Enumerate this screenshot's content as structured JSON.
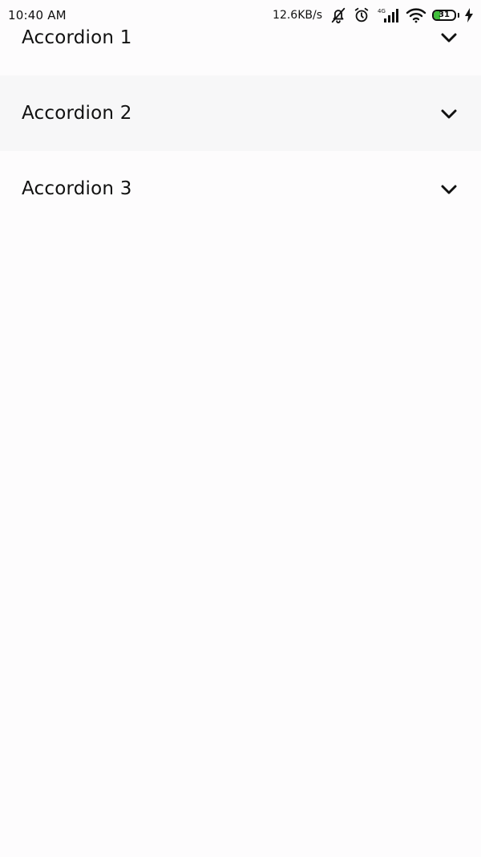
{
  "status_bar": {
    "time": "10:40 AM",
    "net_speed": "12.6KB/s",
    "icons": [
      "mute-icon",
      "alarm-icon",
      "signal-4g-icon",
      "wifi-icon",
      "battery-icon",
      "charging-icon"
    ],
    "network_label": "4G",
    "battery_level": "31",
    "battery_fraction": 0.31,
    "battery_color": "#3fbf3a"
  },
  "accordions": [
    {
      "title": "Accordion 1",
      "icon": "chevron-down-icon"
    },
    {
      "title": "Accordion 2",
      "icon": "chevron-down-icon"
    },
    {
      "title": "Accordion 3",
      "icon": "chevron-down-icon"
    }
  ],
  "colors": {
    "background": "#fdfcfd",
    "text": "#111111"
  }
}
